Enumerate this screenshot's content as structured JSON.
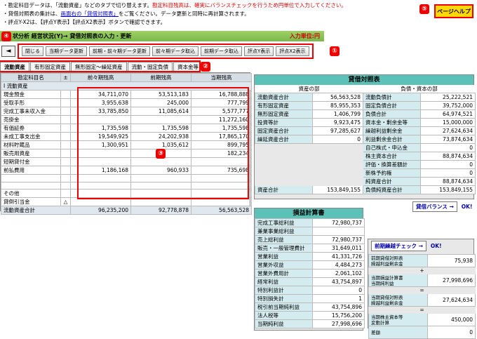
{
  "notes": {
    "line1a": "・勘定科目データは、「流動資産」などのタブで切り替えます。",
    "line1b": "勘定科目残高は、確実にバランスチェックを行うため円単位で入力してください。",
    "line2a": "・貸借対照表の集計は、",
    "line2b": "画面右の「貸借対照表」",
    "line2c": "をご覧ください。データ更新と同時に再計算されます。",
    "line3": "・評点Y-X2は、【評点Y表示】【評点X2表示】ボタンで確認できます。"
  },
  "help_label": "ページヘルプ",
  "badges": {
    "b1": "①",
    "b2": "②",
    "b3": "③",
    "b4": "④",
    "b5": "⑤"
  },
  "title": "状分析 経営状況(Y)→ 貸借対照表の入力・更新",
  "unit": "入力単位:円",
  "back_glyph": "◄",
  "toolbar": [
    "閉じる",
    "当期データ更新",
    "前期・前々期データ更新",
    "前々期データ取込",
    "前期データ取込",
    "評点Y表示",
    "評点X2表示"
  ],
  "tabs": [
    "流動資産",
    "有形固定資産",
    "無形固定～繰延資産",
    "流動・固定負債",
    "資本金等"
  ],
  "main": {
    "headers": [
      "勘定科目名",
      "±",
      "前々期残高",
      "前期残高",
      "当期残高"
    ],
    "category": "Ⅰ 流動資産",
    "rows": [
      {
        "name": "現金預金",
        "sign": "",
        "v1": "34,711,070",
        "v2": "53,513,183",
        "v3": "16,788,888"
      },
      {
        "name": "受取手形",
        "sign": "",
        "v1": "3,955,638",
        "v2": "245,000",
        "v3": "777,799"
      },
      {
        "name": "完成工事未収入金",
        "sign": "",
        "v1": "33,785,850",
        "v2": "11,085,614",
        "v3": "5,577,777"
      },
      {
        "name": "売掛金",
        "sign": "",
        "v1": "",
        "v2": "",
        "v3": "11,272,160"
      },
      {
        "name": "有価証券",
        "sign": "",
        "v1": "1,735,598",
        "v2": "1,735,598",
        "v3": "1,735,598"
      },
      {
        "name": "未成工事支出金",
        "sign": "",
        "v1": "19,549,925",
        "v2": "24,202,938",
        "v3": "17,865,170"
      },
      {
        "name": "材料貯蔵品",
        "sign": "",
        "v1": "1,300,951",
        "v2": "1,035,612",
        "v3": "899,795"
      },
      {
        "name": "販売用資産",
        "sign": "",
        "v1": "",
        "v2": "",
        "v3": "182,234"
      },
      {
        "name": "短期貸付金",
        "sign": "",
        "v1": "",
        "v2": "",
        "v3": ""
      },
      {
        "name": "前払費用",
        "sign": "",
        "v1": "1,186,168",
        "v2": "960,933",
        "v3": "735,698"
      },
      {
        "name": "",
        "sign": "",
        "v1": "",
        "v2": "",
        "v3": ""
      },
      {
        "name": "",
        "sign": "",
        "v1": "",
        "v2": "",
        "v3": ""
      },
      {
        "name": "その他",
        "sign": "",
        "v1": "",
        "v2": "",
        "v3": ""
      },
      {
        "name": "貸倒引当金",
        "sign": "△",
        "v1": "",
        "v2": "",
        "v3": ""
      }
    ],
    "total": {
      "name": "流動資産合計",
      "v1": "96,235,200",
      "v2": "92,778,878",
      "v3": "56,563,528"
    }
  },
  "bs": {
    "title": "貸借対照表",
    "left_head": "資産の部",
    "right_head": "負債・資本の部",
    "left": [
      {
        "l": "流動資産合計",
        "v": "56,563,528"
      },
      {
        "l": "有形固定資産",
        "v": "85,955,353"
      },
      {
        "l": "無形固定資産",
        "v": "1,406,799"
      },
      {
        "l": "投資等計",
        "v": "9,923,475"
      },
      {
        "l": "固定資産合計",
        "v": "97,285,627"
      },
      {
        "l": "繰延資産合計",
        "v": "0"
      }
    ],
    "right": [
      {
        "l": "流動負債計",
        "v": "25,222,521"
      },
      {
        "l": "固定負債合計",
        "v": "39,752,000"
      },
      {
        "l": "負債合計",
        "v": "64,974,521"
      },
      {
        "l": "資本金・剰余金等",
        "v": "15,000,000"
      },
      {
        "l": "繰越利益剰余金",
        "v": "27,624,634"
      },
      {
        "l": "利益剰余金合計",
        "v": "73,874,634"
      },
      {
        "l": "自己株式・申込金",
        "v": "0"
      },
      {
        "l": "株主資本合計",
        "v": "88,874,634"
      },
      {
        "l": "評価・換算差額計",
        "v": "0"
      },
      {
        "l": "新株予約権",
        "v": "0"
      },
      {
        "l": "純資産合計",
        "v": "88,874,634"
      }
    ],
    "asset_total": {
      "l": "資産合計",
      "v": "153,849,155"
    },
    "liab_total": {
      "l": "負債純資産合計",
      "v": "153,849,155"
    }
  },
  "balance_check": {
    "label": "貸借バランス →",
    "result": "OK!"
  },
  "pl": {
    "title": "損益計算書",
    "rows": [
      {
        "l": "完成工事総利益",
        "v": "72,980,737"
      },
      {
        "l": "兼業事業総利益",
        "v": ""
      },
      {
        "l": "売上総利益",
        "v": "72,980,737"
      },
      {
        "l": "販売・一般管理費計",
        "v": "31,649,011"
      },
      {
        "l": "営業利益",
        "v": "41,331,726"
      },
      {
        "l": "営業外収益",
        "v": "4,484,273"
      },
      {
        "l": "営業外費用計",
        "v": "2,061,102"
      },
      {
        "l": "経常利益",
        "v": "43,754,897"
      },
      {
        "l": "特別利益計",
        "v": "0"
      },
      {
        "l": "特別損失計",
        "v": "1"
      },
      {
        "l": "税引前当期純利益",
        "v": "43,754,896"
      },
      {
        "l": "法人税等",
        "v": "15,756,200"
      },
      {
        "l": "当期純利益",
        "v": "27,998,696"
      }
    ]
  },
  "carry": {
    "check_label": "前期繰越チェック →",
    "check_result": "OK!",
    "rows": [
      {
        "l": "前期貸借対照表\n繰越利益剰余金",
        "v": "75,938"
      },
      {
        "op": "+"
      },
      {
        "l": "当期損益計算書\n当期純利益",
        "v": "27,998,696"
      },
      {
        "op": "="
      },
      {
        "l": "当期貸借対照表\n繰越利益剰余金",
        "v": "27,624,634"
      },
      {
        "op": "="
      },
      {
        "l": "当期株主資本等\n変動計算",
        "v": "450,000"
      },
      {
        "l": "差額",
        "v": "0"
      }
    ]
  }
}
